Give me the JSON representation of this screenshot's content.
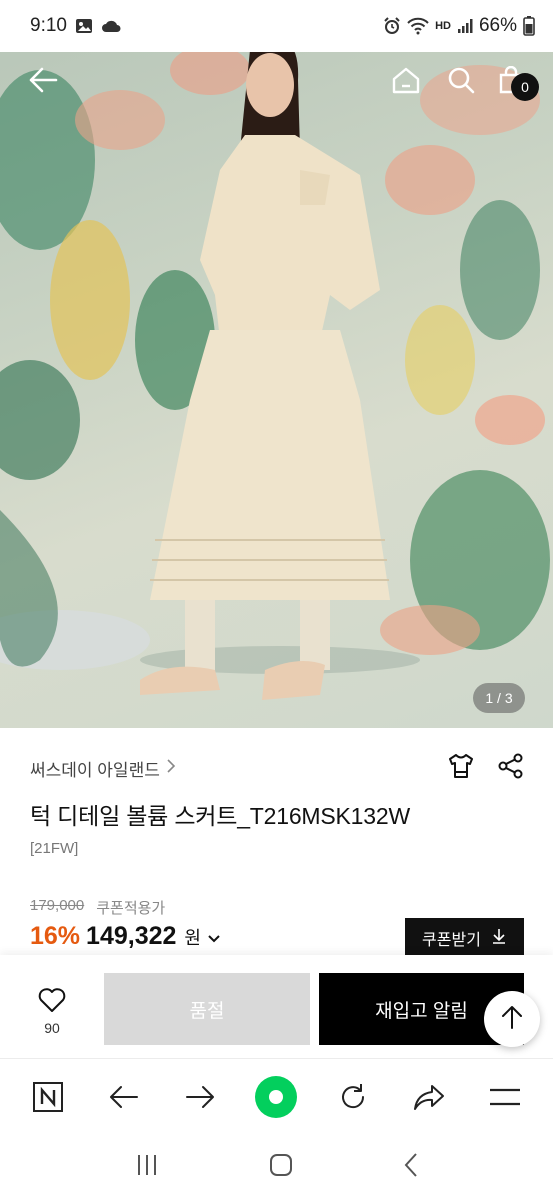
{
  "status_bar": {
    "time": "9:10",
    "battery": "66%",
    "hd_label": "HD"
  },
  "product_image": {
    "page_indicator": "1 / 3"
  },
  "header": {
    "cart_count": "0"
  },
  "product": {
    "brand": "써스데이 아일랜드",
    "title": "턱 디테일 볼륨 스커트_T216MSK132W",
    "season": "[21FW]",
    "original_price": "179,000",
    "coupon_price_label": "쿠폰적용가",
    "discount": "16%",
    "sale_price": "149,322",
    "currency": "원"
  },
  "coupon": {
    "label": "쿠폰받기"
  },
  "actions": {
    "wish_count": "90",
    "soldout_label": "품절",
    "restock_label": "재입고 알림"
  },
  "colors": {
    "discount": "#e55a10",
    "primary_button": "#000000",
    "disabled_button": "#d9d9d9",
    "browser_accent": "#03cf5d"
  },
  "icons": {
    "back": "back-arrow-icon",
    "home": "home-icon",
    "search": "search-icon",
    "cart": "cart-icon",
    "size_guide": "shirt-icon",
    "share": "share-icon",
    "heart": "heart-icon",
    "scroll_top": "arrow-up-icon"
  }
}
